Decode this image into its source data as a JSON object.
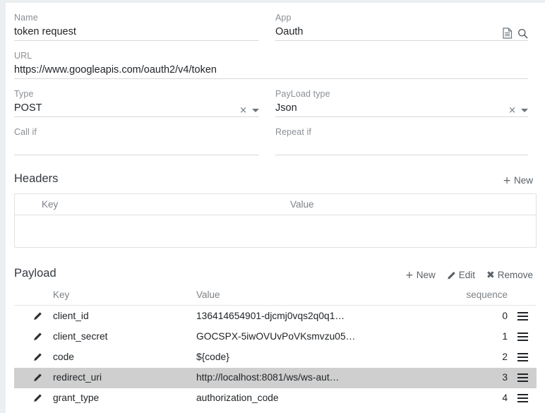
{
  "form": {
    "name": {
      "label": "Name",
      "value": "token request"
    },
    "app": {
      "label": "App",
      "value": "Oauth",
      "doc_icon": "document-icon",
      "search_icon": "search-icon"
    },
    "url": {
      "label": "URL",
      "value": "https://www.googleapis.com/oauth2/v4/token"
    },
    "type": {
      "label": "Type",
      "value": "POST",
      "clear": "×"
    },
    "payload_type": {
      "label": "PayLoad type",
      "value": "Json",
      "clear": "×"
    },
    "call_if": {
      "label": "Call if",
      "value": ""
    },
    "repeat_if": {
      "label": "Repeat if",
      "value": ""
    }
  },
  "headers": {
    "title": "Headers",
    "new_label": "New",
    "new_glyph": "+",
    "columns": [
      "Key",
      "Value"
    ],
    "rows": []
  },
  "payload": {
    "title": "Payload",
    "actions": [
      {
        "label": "New",
        "glyph": "+",
        "icon": "plus-icon"
      },
      {
        "label": "Edit",
        "glyph": "✎",
        "icon": "pencil-icon"
      },
      {
        "label": "Remove",
        "glyph": "✖",
        "icon": "cross-icon"
      }
    ],
    "columns": [
      "Key",
      "Value",
      "sequence"
    ],
    "rows": [
      {
        "key": "client_id",
        "value": "136414654901-djcmj0vqs2q0q1…",
        "sequence": "0",
        "selected": false
      },
      {
        "key": "client_secret",
        "value": "GOCSPX-5iwOVUvPoVKsmvzu05…",
        "sequence": "1",
        "selected": false
      },
      {
        "key": "code",
        "value": "${code}",
        "sequence": "2",
        "selected": false
      },
      {
        "key": "redirect_uri",
        "value": "http://localhost:8081/ws/ws-aut…",
        "sequence": "3",
        "selected": true
      },
      {
        "key": "grant_type",
        "value": "authorization_code",
        "sequence": "4",
        "selected": false
      }
    ]
  },
  "colors": {
    "page_background": "#ffffff",
    "outer_background": "#eceff1",
    "label_text": "#8a8f94",
    "value_text": "#212529",
    "underline": "#d6d8da",
    "selected_row": "#cfcfcf",
    "table_border": "#dfe1e3"
  }
}
